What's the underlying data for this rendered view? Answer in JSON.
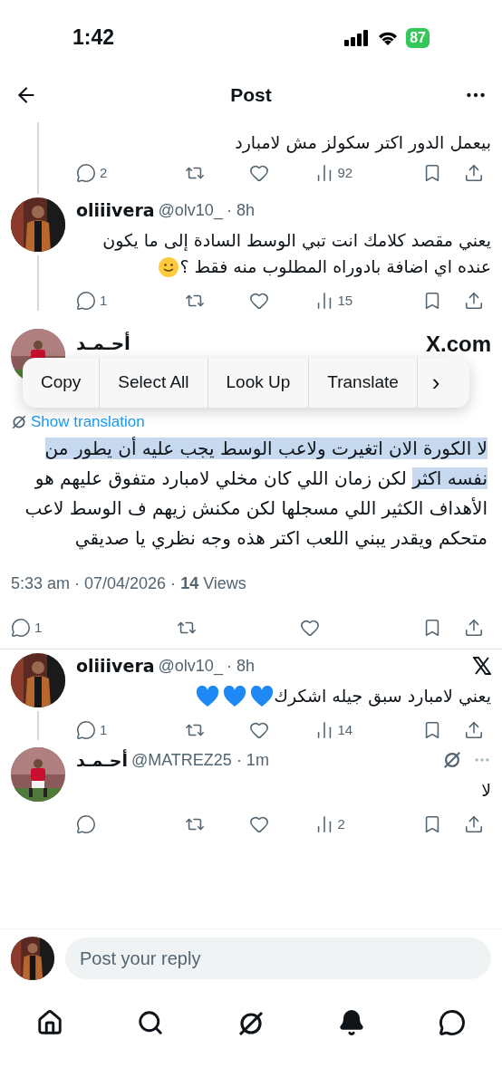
{
  "status_bar": {
    "time": "1:42",
    "battery": "87"
  },
  "header": {
    "title": "Post"
  },
  "top_post": {
    "text": "بيعمل الدور اكتر سكولز مش لامبارد",
    "replies": "2",
    "views": "92"
  },
  "reply_before": {
    "name": "oliiivera",
    "handle": "@olv10_",
    "time": "· 8h",
    "text": "يعني مقصد كلامك انت تبي الوسط السادة إلى ما يكون عنده اي اضافة بادوراه المطلوب منه فقط ؟",
    "emojis": [
      {
        "kind": "smile"
      }
    ],
    "replies": "1",
    "views": "15"
  },
  "main_post": {
    "name": "أحـمـد",
    "overlay_site": "X.com",
    "menu": {
      "copy": "Copy",
      "select_all": "Select All",
      "look_up": "Look Up",
      "translate": "Translate",
      "more": "›"
    },
    "show_translation": "Show translation",
    "selected_text": "لا الكورة الان اتغيرت ولاعب الوسط يجب عليه أن يطور من نفسه اكثر",
    "rest_text": "لكن زمان اللي كان مخلي لامبارد متفوق عليهم هو الأهداف الكثير اللي مسجلها لكن مكنش زيهم ف الوسط لاعب متحكم ويقدر يبني اللعب اكتر هذه وجه نظري يا صديقي",
    "meta": "5:33 am · 07/04/2026 · **14** Views",
    "replies": "1"
  },
  "replies_after": [
    {
      "kind": "x-badge",
      "name": "oliiivera",
      "handle": "@olv10_",
      "time": "· 8h",
      "text": "يعني لامبارد سبق جيله اشكرك",
      "emojis": [
        {
          "kind": "blue-heart"
        },
        {
          "kind": "blue-heart"
        },
        {
          "kind": "blue-heart"
        }
      ],
      "replies": "1",
      "views": "14"
    },
    {
      "kind": "grok-badge",
      "name": "أحـمـد",
      "handle": "@MATREZ25 · 1m",
      "text": "لا",
      "views": "2"
    }
  ],
  "composer": {
    "placeholder": "Post your reply"
  },
  "nav": [
    {
      "kind": "home",
      "selected": false
    },
    {
      "kind": "search",
      "selected": false
    },
    {
      "kind": "grok",
      "selected": false
    },
    {
      "kind": "bell",
      "selected": true
    },
    {
      "kind": "chat",
      "selected": false
    }
  ]
}
